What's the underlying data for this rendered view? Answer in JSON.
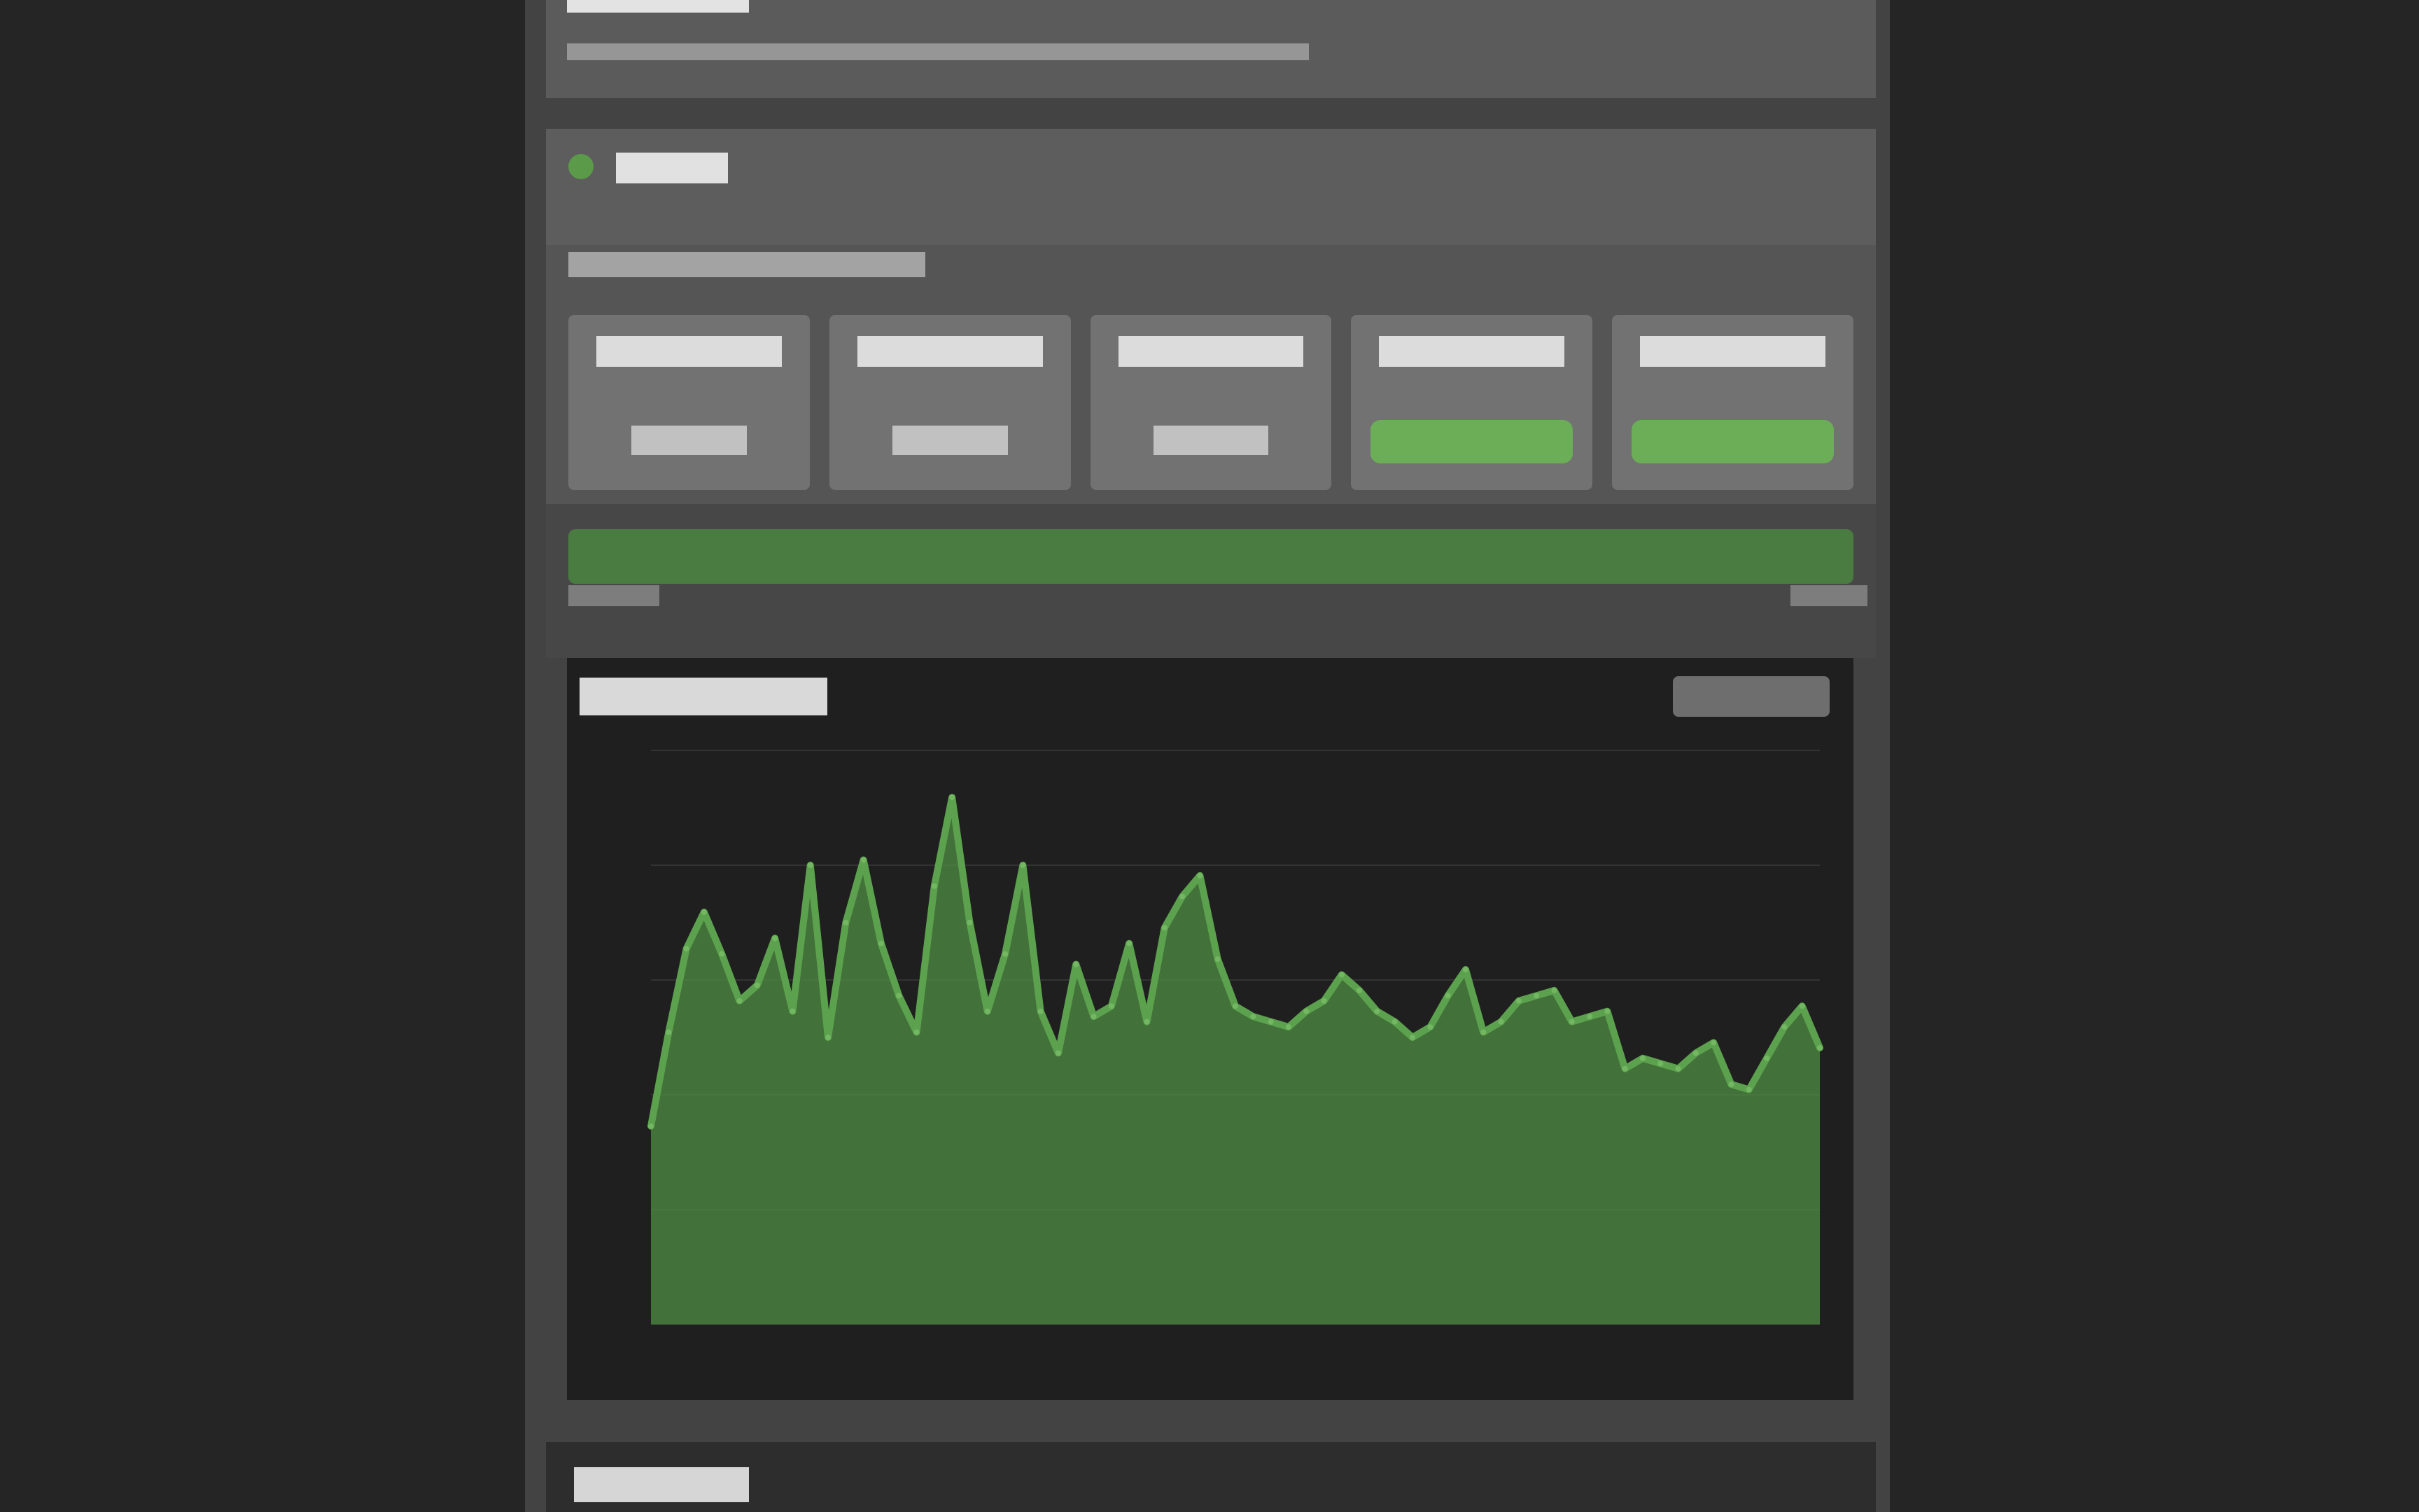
{
  "chart_data": {
    "type": "area",
    "series": [
      {
        "values": [
          38,
          56,
          72,
          79,
          71,
          62,
          65,
          74,
          60,
          88,
          55,
          77,
          89,
          73,
          63,
          56,
          84,
          101,
          77,
          60,
          71,
          88,
          60,
          52,
          69,
          59,
          61,
          73,
          58,
          76,
          82,
          86,
          70,
          61,
          59,
          58,
          57,
          60,
          62,
          67,
          64,
          60,
          58,
          55,
          57,
          63,
          68,
          56,
          58,
          62,
          63,
          64,
          58,
          59,
          60,
          49,
          51,
          50,
          49,
          52,
          54,
          46,
          45,
          51,
          57,
          61,
          53
        ]
      }
    ],
    "grid": true
  }
}
